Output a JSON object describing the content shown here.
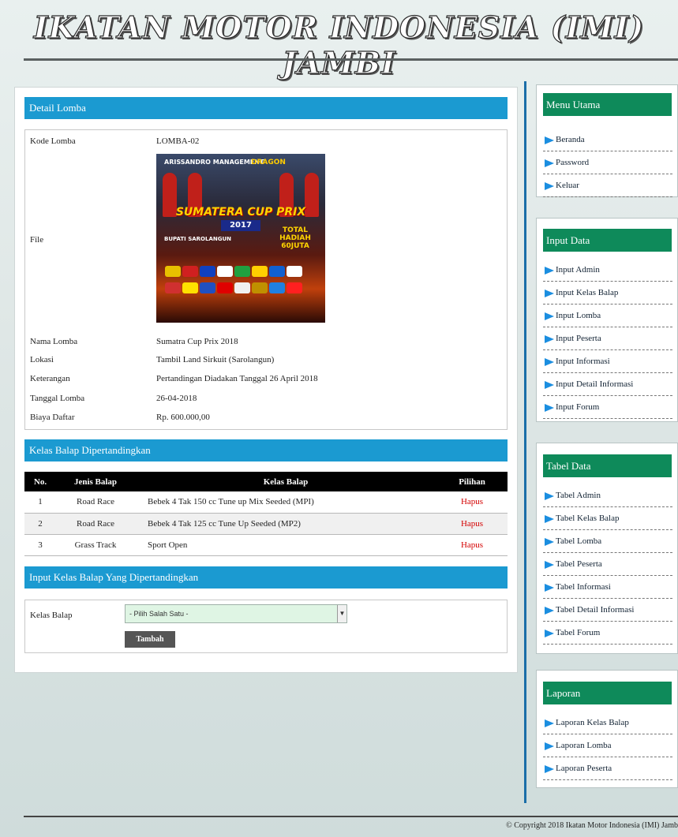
{
  "header": {
    "title": "IKATAN MOTOR INDONESIA (IMI) JAMBI"
  },
  "detail": {
    "section_title": "Detail Lomba",
    "kode_label": "Kode Lomba",
    "kode_value": "LOMBA-02",
    "file_label": "File",
    "nama_label": "Nama Lomba",
    "nama_value": "Sumatra Cup Prix 2018",
    "lokasi_label": "Lokasi",
    "lokasi_value": "Tambil Land Sirkuit (Sarolangun)",
    "keterangan_label": "Keterangan",
    "keterangan_value": "Pertandingan Diadakan Tanggal 26 April 2018",
    "tanggal_label": "Tanggal Lomba",
    "tanggal_value": "26-04-2018",
    "biaya_label": "Biaya Daftar",
    "biaya_value": "Rp. 600.000,00"
  },
  "poster": {
    "top_left": "ARISSANDRO MANAGEMENT",
    "top_right": "DRAGON",
    "title": "SUMATERA CUP PRIX",
    "year": "2017",
    "subtitle": "BUPATI SAROLANGUN",
    "total": "TOTAL HADIAH 60JUTA"
  },
  "kelas": {
    "section_title": "Kelas Balap Dipertandingkan",
    "columns": [
      "No.",
      "Jenis Balap",
      "Kelas Balap",
      "Pilihan"
    ],
    "rows": [
      {
        "no": "1",
        "jenis": "Road Race",
        "kelas": "Bebek 4 Tak 150 cc Tune up Mix Seeded (MPI)",
        "aksi": "Hapus"
      },
      {
        "no": "2",
        "jenis": "Road Race",
        "kelas": "Bebek 4 Tak 125 cc Tune Up Seeded (MP2)",
        "aksi": "Hapus"
      },
      {
        "no": "3",
        "jenis": "Grass Track",
        "kelas": "Sport Open",
        "aksi": "Hapus"
      }
    ]
  },
  "form": {
    "section_title": "Input Kelas Balap Yang Dipertandingkan",
    "label": "Kelas Balap",
    "select_value": "- Pilih Salah Satu -",
    "button": "Tambah"
  },
  "sidebar": {
    "menu_utama": {
      "title": "Menu Utama",
      "items": [
        "Beranda",
        "Password",
        "Keluar"
      ]
    },
    "input_data": {
      "title": "Input Data",
      "items": [
        "Input Admin",
        "Input Kelas Balap",
        "Input Lomba",
        "Input Peserta",
        "Input Informasi",
        "Input Detail Informasi",
        "Input Forum"
      ]
    },
    "tabel_data": {
      "title": "Tabel Data",
      "items": [
        "Tabel Admin",
        "Tabel Kelas Balap",
        "Tabel Lomba",
        "Tabel Peserta",
        "Tabel Informasi",
        "Tabel Detail Informasi",
        "Tabel Forum"
      ]
    },
    "laporan": {
      "title": "Laporan",
      "items": [
        "Laporan Kelas Balap",
        "Laporan Lomba",
        "Laporan Peserta"
      ]
    }
  },
  "footer": {
    "copyright": "© Copyright 2018 Ikatan Motor Indonesia (IMI) Jamb"
  },
  "colors": {
    "section_bar": "#1b9ad1",
    "sidebar_head": "#0e8a5a",
    "hapus": "#d40000"
  }
}
